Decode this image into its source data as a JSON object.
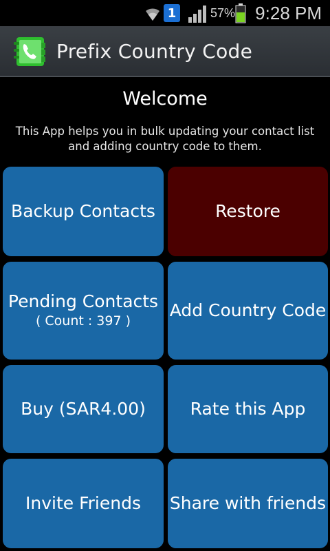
{
  "status_bar": {
    "notification_count": "1",
    "battery_percent": "57%",
    "time": "9:28 PM"
  },
  "app": {
    "title": "Prefix Country Code",
    "icon": "phone-book-icon"
  },
  "welcome": {
    "heading": "Welcome",
    "description": "This App helps you in bulk updating your contact list and adding country code to them."
  },
  "buttons": {
    "backup": "Backup Contacts",
    "restore": "Restore",
    "pending": "Pending Contacts",
    "pending_count": "( Count : 397 )",
    "add_country_code": "Add Country Code",
    "buy": "Buy (SAR4.00)",
    "rate": "Rate this App",
    "invite": "Invite Friends",
    "share": "Share with friends"
  },
  "colors": {
    "tile_blue": "#1a68a6",
    "tile_red": "#4b0000",
    "icon_green": "#2fbf2f"
  }
}
